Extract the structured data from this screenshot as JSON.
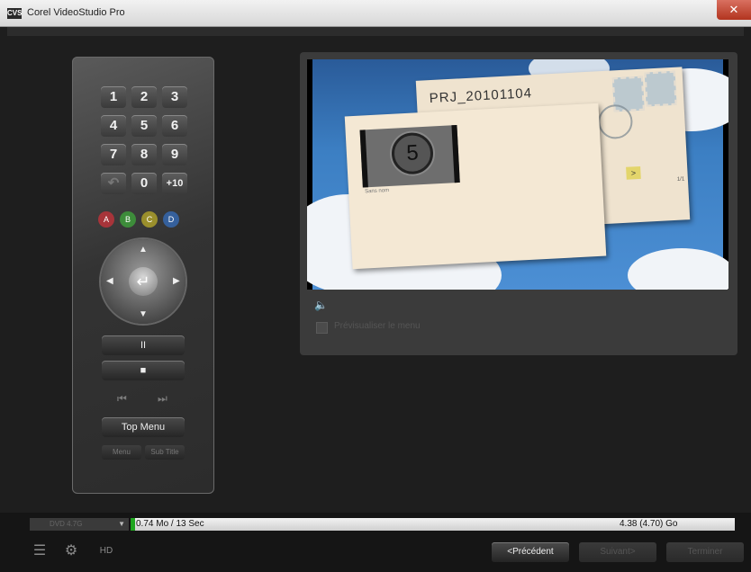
{
  "window": {
    "title": "Corel VideoStudio Pro",
    "icon_label": "CVS",
    "close_label": "✕"
  },
  "remote": {
    "keys": [
      "1",
      "2",
      "3",
      "4",
      "5",
      "6",
      "7",
      "8",
      "9",
      "↶",
      "0",
      "+10"
    ],
    "color_buttons": [
      "A",
      "B",
      "C",
      "D"
    ],
    "pause_label": "II",
    "stop_label": "■",
    "prev_label": "⏮",
    "next_label": "⏭",
    "top_menu_label": "Top Menu",
    "menu_label": "Menu",
    "subtitle_label": "Sub Title"
  },
  "preview": {
    "project_name": "PRJ_20101104",
    "countdown_number": "5",
    "clip_name": "Sans nom",
    "page_indicator": "1/1",
    "next_symbol": ">",
    "volume_icon": "speaker-icon",
    "checkbox_label": "Prévisualiser le menu"
  },
  "bottom": {
    "disc_format": "DVD 4.7G",
    "space_used": "0.74 Mo / 13 Sec",
    "space_total": "4.38 (4.70) Go",
    "space_used_fraction": 0.007,
    "previous_button": "<Précédent",
    "next_button": "Suivant>",
    "finish_button": "Terminer",
    "tool_icons": [
      "list-icon",
      "settings-icon",
      "hd-icon"
    ]
  }
}
